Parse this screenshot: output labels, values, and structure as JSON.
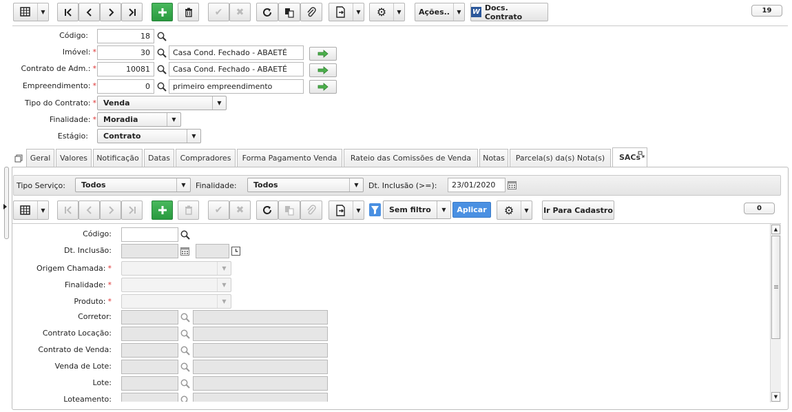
{
  "toolbar": {
    "acoes_label": "Ações..",
    "docs_label": "Docs. Contrato",
    "record_count": "19"
  },
  "header_form": {
    "codigo_label": "Código:",
    "codigo_value": "18",
    "imovel_label": "Imóvel:",
    "imovel_value": "30",
    "imovel_desc": "Casa Cond. Fechado - ABAETÉ",
    "contrato_label": "Contrato de Adm.:",
    "contrato_value": "10081",
    "contrato_desc": "Casa Cond. Fechado - ABAETÉ",
    "empreendimento_label": "Empreendimento:",
    "empreendimento_value": "0",
    "empreendimento_desc": "primeiro empreendimento",
    "tipo_label": "Tipo do Contrato:",
    "tipo_value": "Venda",
    "finalidade_label": "Finalidade:",
    "finalidade_value": "Moradia",
    "estagio_label": "Estágio:",
    "estagio_value": "Contrato",
    "required_mark": "*"
  },
  "tabs": [
    {
      "label": "Geral"
    },
    {
      "label": "Valores"
    },
    {
      "label": "Notificação"
    },
    {
      "label": "Datas"
    },
    {
      "label": "Compradores"
    },
    {
      "label": "Forma Pagamento Venda"
    },
    {
      "label": "Rateio das Comissões de Venda"
    },
    {
      "label": "Notas"
    },
    {
      "label": "Parcela(s) da(s) Nota(s)"
    },
    {
      "label": "SACs"
    }
  ],
  "filter": {
    "tipo_servico_label": "Tipo Serviço:",
    "tipo_servico_value": "Todos",
    "finalidade_label": "Finalidade:",
    "finalidade_value": "Todos",
    "dt_inclusao_label": "Dt. Inclusão (>=):",
    "dt_inclusao_value": "23/01/2020"
  },
  "sub_toolbar": {
    "filter_select": "Sem filtro",
    "apply_label": "Aplicar",
    "goto_label": "Ir Para Cadastro",
    "record_count": "0"
  },
  "sac_form": {
    "codigo_label": "Código:",
    "dt_inclusao_label": "Dt. Inclusão:",
    "origem_label": "Origem Chamada:",
    "finalidade_label": "Finalidade:",
    "produto_label": "Produto:",
    "corretor_label": "Corretor:",
    "contrato_locacao_label": "Contrato Locação:",
    "contrato_venda_label": "Contrato de Venda:",
    "venda_lote_label": "Venda de Lote:",
    "lote_label": "Lote:",
    "loteamento_label": "Loteamento:"
  },
  "colors": {
    "accent_blue": "#4a90e2",
    "add_green": "#2ea44f",
    "required_red": "#d33333"
  }
}
